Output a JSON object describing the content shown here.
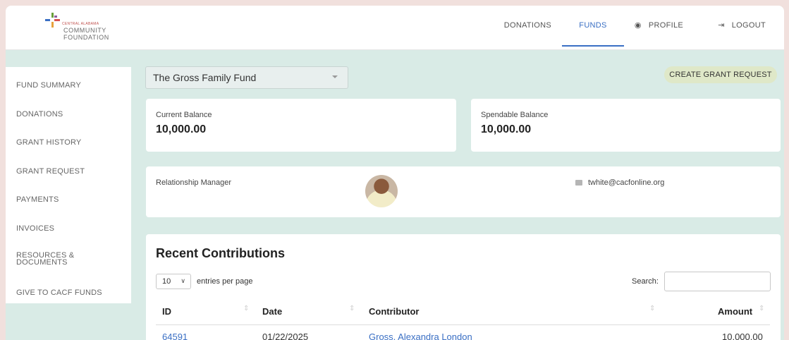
{
  "logo": {
    "small_text": "CENTRAL ALABAMA",
    "line1": "COMMUNITY",
    "line2": "FOUNDATION"
  },
  "nav": {
    "donations": "DONATIONS",
    "funds": "FUNDS",
    "profile": "PROFILE",
    "logout": "LOGOUT",
    "active": "FUNDS"
  },
  "sidebar": {
    "items": [
      {
        "label": "FUND SUMMARY"
      },
      {
        "label": "DONATIONS"
      },
      {
        "label": "GRANT HISTORY"
      },
      {
        "label": "GRANT REQUEST"
      },
      {
        "label": "PAYMENTS"
      },
      {
        "label": "INVOICES"
      },
      {
        "label": "RESOURCES &\nDOCUMENTS"
      },
      {
        "label": "GIVE TO CACF FUNDS"
      }
    ]
  },
  "fund_select": {
    "value": "The Gross Family Fund"
  },
  "actions": {
    "create_grant_request": "CREATE GRANT REQUEST"
  },
  "balances": {
    "current_label": "Current Balance",
    "current_value": "10,000.00",
    "spendable_label": "Spendable Balance",
    "spendable_value": "10,000.00"
  },
  "relationship": {
    "label": "Relationship Manager",
    "email": "twhite@cacfonline.org"
  },
  "contributions": {
    "title": "Recent Contributions",
    "entries_value": "10",
    "entries_label": "entries per page",
    "search_label": "Search:",
    "search_value": "",
    "columns": [
      "ID",
      "Date",
      "Contributor",
      "Amount"
    ],
    "rows": [
      {
        "id": "64591",
        "date": "01/22/2025",
        "contributor": "Gross, Alexandra London",
        "amount": "10,000.00"
      }
    ]
  },
  "colors": {
    "accent": "#3a6fc4",
    "page_bg": "#d9ebe6",
    "button_bg": "#dfe8c8"
  }
}
